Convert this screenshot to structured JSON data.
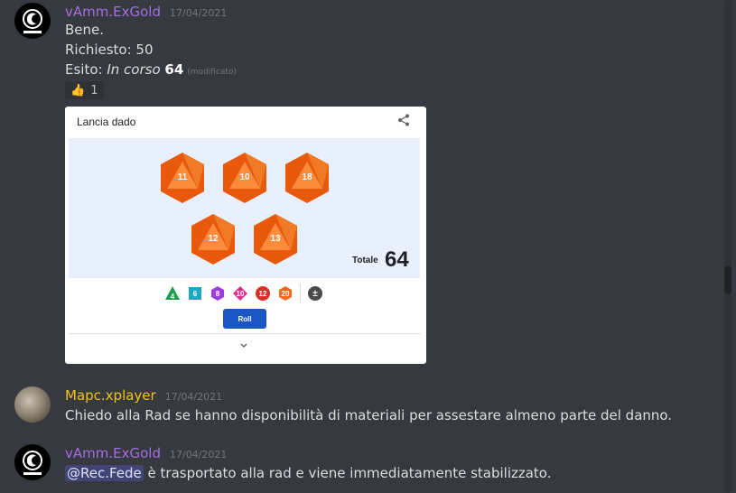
{
  "messages": [
    {
      "username": "vAmm.ExGold",
      "timestamp": "17/04/2021",
      "lines": [
        "Bene.",
        "Richiesto: 50"
      ],
      "outcome": {
        "prefix": "Esito: ",
        "status": "In corso",
        "value": "64",
        "edited": "(modificato)"
      },
      "reaction": {
        "emoji": "👍",
        "count": "1"
      }
    },
    {
      "username": "Mapc.xplayer",
      "timestamp": "17/04/2021",
      "text": "Chiedo alla Rad se hanno disponibilità di materiali per assestare almeno parte del danno."
    },
    {
      "username": "vAmm.ExGold",
      "timestamp": "17/04/2021",
      "mention": "@Rec.Fede",
      "text": " è trasportato alla rad e viene immediatamente stabilizzato."
    }
  ],
  "dice_card": {
    "title": "Lancia dado",
    "dice_results": [
      "11",
      "10",
      "18",
      "12",
      "13"
    ],
    "total_label": "Totale",
    "total_value": "64",
    "dice_types": [
      "4",
      "6",
      "8",
      "10",
      "12",
      "20",
      "±"
    ],
    "roll_label": "Roll"
  },
  "colors": {
    "background": "#36393f",
    "die_orange": "#f26b1d",
    "roll_button": "#1a56c4",
    "username_purple": "#a56de2",
    "username_gold": "#f1c40f"
  }
}
